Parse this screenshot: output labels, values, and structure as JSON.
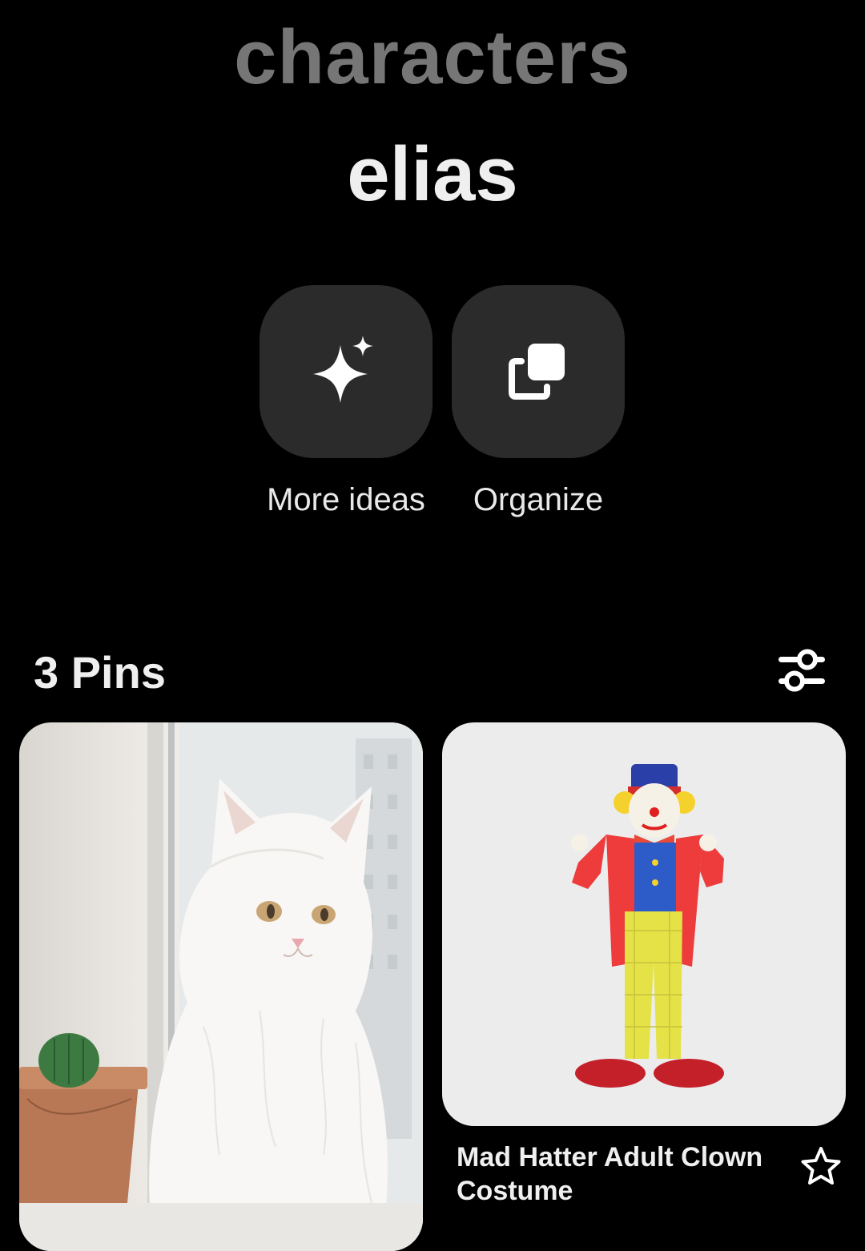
{
  "board": {
    "parent_title": "characters",
    "title": "elias"
  },
  "actions": [
    {
      "label": "More ideas",
      "icon": "sparkle-icon"
    },
    {
      "label": "Organize",
      "icon": "organize-icon"
    }
  ],
  "pins_header": {
    "count_label": "3 Pins",
    "filter_icon": "filter-sliders-icon"
  },
  "pins": [
    {
      "image": "white-cat-photo",
      "title": ""
    },
    {
      "image": "clown-costume-photo",
      "title": "Mad Hatter Adult Clown Costume",
      "icon": "star-icon"
    }
  ],
  "colors": {
    "background": "#000000",
    "button_bg": "#2b2b2b",
    "parent_title": "#767676",
    "text": "#efefef"
  }
}
